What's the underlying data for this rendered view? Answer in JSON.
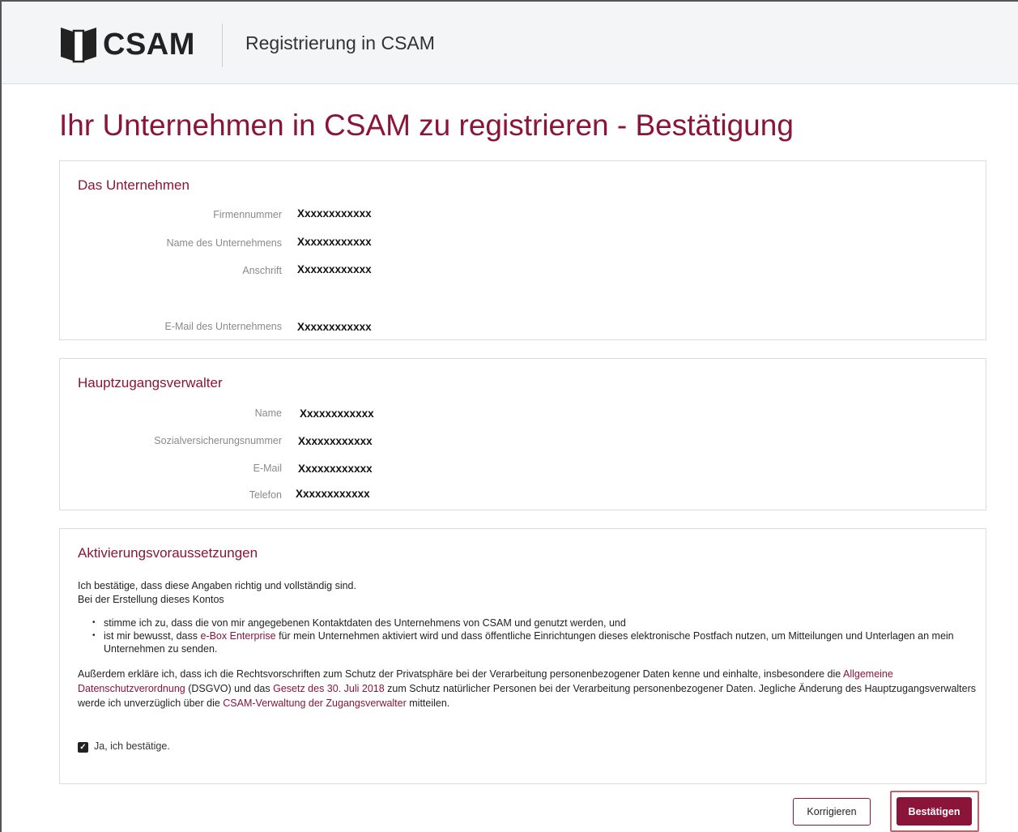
{
  "header": {
    "logo_text": "CSAM",
    "title": "Registrierung in CSAM"
  },
  "page_title": "Ihr Unternehmen in CSAM zu registrieren - Bestätigung",
  "company": {
    "section_title": "Das Unternehmen",
    "rows": [
      {
        "label": "Firmennummer",
        "value": "Xxxxxxxxxxxx"
      },
      {
        "label": "Name des Unternehmens",
        "value": "Xxxxxxxxxxxx"
      },
      {
        "label": "Anschrift",
        "value": "Xxxxxxxxxxxx"
      },
      {
        "label": "E-Mail des Unternehmens",
        "value": "Xxxxxxxxxxxx"
      }
    ]
  },
  "admin": {
    "section_title": "Hauptzugangsverwalter",
    "rows": [
      {
        "label": "Name",
        "value": "Xxxxxxxxxxxx"
      },
      {
        "label": "Sozialversicherungsnummer",
        "value": "Xxxxxxxxxxxx"
      },
      {
        "label": "E-Mail",
        "value": "Xxxxxxxxxxxx"
      },
      {
        "label": "Telefon",
        "value": "Xxxxxxxxxxxx"
      }
    ]
  },
  "activation": {
    "section_title": "Aktivierungsvoraussetzungen",
    "intro_line1": "Ich bestätige, dass diese Angaben richtig und vollständig sind.",
    "intro_line2": "Bei der Erstellung dieses Kontos",
    "bullet1": "stimme ich zu, dass die von mir angegebenen Kontaktdaten des Unternehmens von CSAM und genutzt werden, und",
    "bullet2_pre": "ist mir bewusst, dass ",
    "bullet2_link": "e-Box Enterprise",
    "bullet2_post": " für mein Unternehmen aktiviert wird und dass öffentliche Einrichtungen dieses elektronische Postfach nutzen, um Mitteilungen und Unterlagen an mein Unternehmen zu senden.",
    "para_pre": "Außerdem erkläre ich, dass ich die Rechtsvorschriften zum Schutz der Privatsphäre bei der Verarbeitung personenbezogener Daten kenne und einhalte, insbesondere die ",
    "para_link1": "Allgemeine Datenschutzverordnung",
    "para_mid1": " (DSGVO) und das ",
    "para_link2": "Gesetz des 30. Juli 2018",
    "para_mid2": " zum Schutz natürlicher Personen bei der Verarbeitung personenbezogener Daten. Jegliche Änderung des Hauptzugangsverwalters werde ich unverzüglich über die ",
    "para_link3": "CSAM-Verwaltung der Zugangsverwalter",
    "para_post": " mitteilen.",
    "checkbox_label": "Ja, ich bestätige.",
    "checkbox_checked": true
  },
  "buttons": {
    "secondary": "Korrigieren",
    "primary": "Bestätigen"
  },
  "colors": {
    "accent": "#8a1538"
  }
}
